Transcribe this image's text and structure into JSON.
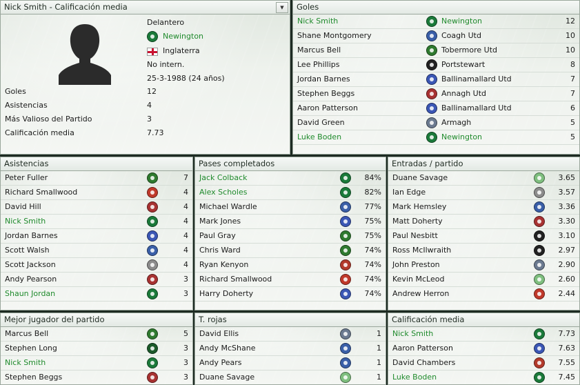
{
  "profile": {
    "title": "Nick Smith - Calificación media",
    "position": "Delantero",
    "club": "Newington",
    "nation": "Inglaterra",
    "status": "No intern.",
    "dob": "25-3-1988 (24 años)",
    "stats": [
      {
        "label": "Goles",
        "value": "12"
      },
      {
        "label": "Asistencias",
        "value": "4"
      },
      {
        "label": "Más Valioso del Partido",
        "value": "3"
      },
      {
        "label": "Calificación media",
        "value": "7.73"
      }
    ]
  },
  "goles": {
    "title": "Goles",
    "rows": [
      {
        "name": "Nick Smith",
        "club": "Newington",
        "crest": "#1b7a3a",
        "value": "12",
        "hl": true
      },
      {
        "name": "Shane Montgomery",
        "club": "Coagh Utd",
        "crest": "#3a5fa8",
        "value": "10",
        "hl": false
      },
      {
        "name": "Marcus Bell",
        "club": "Tobermore Utd",
        "crest": "#2f7a2f",
        "value": "10",
        "hl": false
      },
      {
        "name": "Lee Phillips",
        "club": "Portstewart",
        "crest": "#222222",
        "value": "8",
        "hl": false
      },
      {
        "name": "Jordan Barnes",
        "club": "Ballinamallard Utd",
        "crest": "#3b57b5",
        "value": "7",
        "hl": false
      },
      {
        "name": "Stephen Beggs",
        "club": "Annagh Utd",
        "crest": "#a83232",
        "value": "7",
        "hl": false
      },
      {
        "name": "Aaron Patterson",
        "club": "Ballinamallard Utd",
        "crest": "#3b57b5",
        "value": "6",
        "hl": false
      },
      {
        "name": "David Green",
        "club": "Armagh",
        "crest": "#6b7a90",
        "value": "5",
        "hl": false
      },
      {
        "name": "Luke Boden",
        "club": "Newington",
        "crest": "#1b7a3a",
        "value": "5",
        "hl": true
      }
    ]
  },
  "asistencias": {
    "title": "Asistencias",
    "rows": [
      {
        "name": "Peter Fuller",
        "crest": "#2f7a2f",
        "value": "7",
        "hl": false
      },
      {
        "name": "Richard Smallwood",
        "crest": "#c0392b",
        "value": "4",
        "hl": false
      },
      {
        "name": "David Hill",
        "crest": "#a83232",
        "value": "4",
        "hl": false
      },
      {
        "name": "Nick Smith",
        "crest": "#1b7a3a",
        "value": "4",
        "hl": true
      },
      {
        "name": "Jordan Barnes",
        "crest": "#3b57b5",
        "value": "4",
        "hl": false
      },
      {
        "name": "Scott Walsh",
        "crest": "#3a5fa8",
        "value": "4",
        "hl": false
      },
      {
        "name": "Scott Jackson",
        "crest": "#8c8c8c",
        "value": "4",
        "hl": false
      },
      {
        "name": "Andy Pearson",
        "crest": "#a83232",
        "value": "3",
        "hl": false
      },
      {
        "name": "Shaun Jordan",
        "crest": "#1b7a3a",
        "value": "3",
        "hl": true
      }
    ]
  },
  "pases": {
    "title": "Pases completados",
    "rows": [
      {
        "name": "Jack Colback",
        "crest": "#1b7a3a",
        "value": "84%",
        "hl": true
      },
      {
        "name": "Alex Scholes",
        "crest": "#1b7a3a",
        "value": "82%",
        "hl": true
      },
      {
        "name": "Michael Wardle",
        "crest": "#3a5fa8",
        "value": "77%",
        "hl": false
      },
      {
        "name": "Mark Jones",
        "crest": "#3b57b5",
        "value": "75%",
        "hl": false
      },
      {
        "name": "Paul Gray",
        "crest": "#2f7a2f",
        "value": "75%",
        "hl": false
      },
      {
        "name": "Chris Ward",
        "crest": "#2f7a2f",
        "value": "74%",
        "hl": false
      },
      {
        "name": "Ryan Kenyon",
        "crest": "#b33a2b",
        "value": "74%",
        "hl": false
      },
      {
        "name": "Richard Smallwood",
        "crest": "#c0392b",
        "value": "74%",
        "hl": false
      },
      {
        "name": "Harry Doherty",
        "crest": "#3b57b5",
        "value": "74%",
        "hl": false
      }
    ]
  },
  "entradas": {
    "title": "Entradas / partido",
    "rows": [
      {
        "name": "Duane Savage",
        "crest": "#7fbf7f",
        "value": "3.65",
        "hl": false
      },
      {
        "name": "Ian Edge",
        "crest": "#8c8c8c",
        "value": "3.57",
        "hl": false
      },
      {
        "name": "Mark Hemsley",
        "crest": "#3a5fa8",
        "value": "3.36",
        "hl": false
      },
      {
        "name": "Matt Doherty",
        "crest": "#a83232",
        "value": "3.30",
        "hl": false
      },
      {
        "name": "Paul Nesbitt",
        "crest": "#222222",
        "value": "3.10",
        "hl": false
      },
      {
        "name": "Ross McIlwraith",
        "crest": "#222222",
        "value": "2.97",
        "hl": false
      },
      {
        "name": "John Preston",
        "crest": "#6b7a90",
        "value": "2.90",
        "hl": false
      },
      {
        "name": "Kevin McLeod",
        "crest": "#7fbf7f",
        "value": "2.60",
        "hl": false
      },
      {
        "name": "Andrew Herron",
        "crest": "#c0392b",
        "value": "2.44",
        "hl": false
      }
    ]
  },
  "mejor": {
    "title": "Mejor jugador del partido",
    "rows": [
      {
        "name": "Marcus Bell",
        "crest": "#2f7a2f",
        "value": "5",
        "hl": false
      },
      {
        "name": "Stephen Long",
        "crest": "#1b5a2a",
        "value": "3",
        "hl": false
      },
      {
        "name": "Nick Smith",
        "crest": "#1b7a3a",
        "value": "3",
        "hl": true
      },
      {
        "name": "Stephen Beggs",
        "crest": "#a83232",
        "value": "3",
        "hl": false
      }
    ]
  },
  "rojas": {
    "title": "T. rojas",
    "rows": [
      {
        "name": "David Ellis",
        "crest": "#6b7a90",
        "value": "1",
        "hl": false
      },
      {
        "name": "Andy McShane",
        "crest": "#3a5fa8",
        "value": "1",
        "hl": false
      },
      {
        "name": "Andy Pears",
        "crest": "#3a5fa8",
        "value": "1",
        "hl": false
      },
      {
        "name": "Duane Savage",
        "crest": "#7fbf7f",
        "value": "1",
        "hl": false
      }
    ]
  },
  "calificacion": {
    "title": "Calificación media",
    "rows": [
      {
        "name": "Nick Smith",
        "crest": "#1b7a3a",
        "value": "7.73",
        "hl": true
      },
      {
        "name": "Aaron Patterson",
        "crest": "#3b57b5",
        "value": "7.63",
        "hl": false
      },
      {
        "name": "David Chambers",
        "crest": "#b33a2b",
        "value": "7.55",
        "hl": false
      },
      {
        "name": "Luke Boden",
        "crest": "#1b7a3a",
        "value": "7.45",
        "hl": true
      }
    ]
  }
}
